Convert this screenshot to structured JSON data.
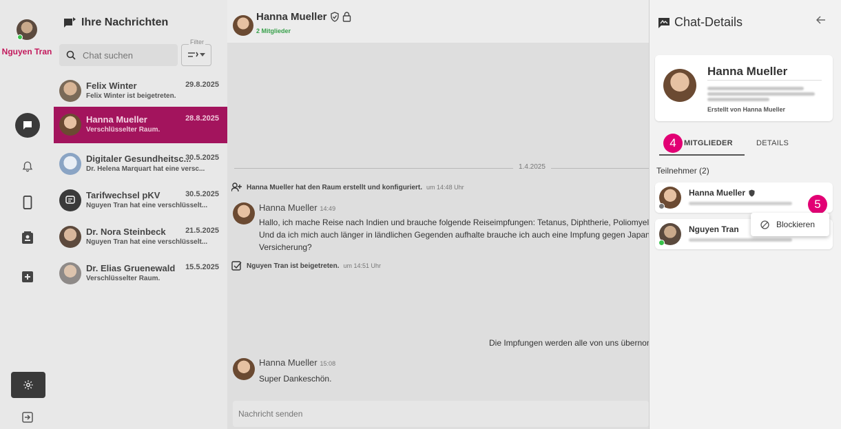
{
  "user": {
    "name": "Nguyen Tran"
  },
  "list": {
    "title": "Ihre Nachrichten",
    "search_placeholder": "Chat suchen",
    "filter_label": "Filter",
    "conversations": [
      {
        "name": "Felix Winter",
        "date": "29.8.2025",
        "sub": "Felix Winter ist beigetreten."
      },
      {
        "name": "Hanna Mueller",
        "date": "28.8.2025",
        "sub": "Verschlüsselter Raum."
      },
      {
        "name": "Digitaler Gesundheitsc...",
        "date": "30.5.2025",
        "sub": "Dr. Helena Marquart hat eine versc..."
      },
      {
        "name": "Tarifwechsel pKV",
        "date": "30.5.2025",
        "sub": "Nguyen Tran hat eine verschlüsselt..."
      },
      {
        "name": "Dr. Nora Steinbeck",
        "date": "21.5.2025",
        "sub": "Nguyen Tran hat eine verschlüsselt..."
      },
      {
        "name": "Dr. Elias Gruenewald",
        "date": "15.5.2025",
        "sub": "Verschlüsselter Raum."
      }
    ]
  },
  "chat": {
    "title": "Hanna Mueller",
    "members": "2 Mitglieder",
    "date_separator": "1.4.2025",
    "event_created": {
      "text": "Hanna Mueller hat den Raum erstellt und konfiguriert.",
      "time": "um 14:48 Uhr"
    },
    "message1": {
      "author": "Hanna Mueller",
      "time": "14:49",
      "line1": "Hallo, ich mache Reise nach Indien und brauche folgende Reiseimpfungen: Tetanus, Diphtherie, Poliomyelitis, Hepa",
      "line2": "Und da ich mich auch länger in ländlichen Gegenden aufhalte brauche ich auch eine Impfung gegen Japanische En",
      "line3": "Versicherung?"
    },
    "event_joined": {
      "text": "Nguyen Tran ist beigetreten.",
      "time": "um 14:51 Uhr"
    },
    "outgoing": "Die Impfungen werden alle von uns übernomm",
    "message2": {
      "author": "Hanna Mueller",
      "time": "15:08",
      "body": "Super Dankeschön."
    },
    "composer_placeholder": "Nachricht senden"
  },
  "details": {
    "title": "Chat-Details",
    "card": {
      "name": "Hanna Mueller",
      "created_by": "Erstellt von Hanna Mueller"
    },
    "tabs": [
      {
        "label": "MITGLIEDER"
      },
      {
        "label": "DETAILS"
      }
    ],
    "badges": {
      "step4": "4",
      "step5": "5"
    },
    "section_title": "Teilnehmer (2)",
    "members": [
      {
        "name": "Hanna Mueller"
      },
      {
        "name": "Nguyen Tran"
      }
    ],
    "block_label": "Blockieren"
  },
  "colors": {
    "accent": "#a3145d",
    "magenta_badge": "#e20074",
    "online": "#37c24a"
  }
}
